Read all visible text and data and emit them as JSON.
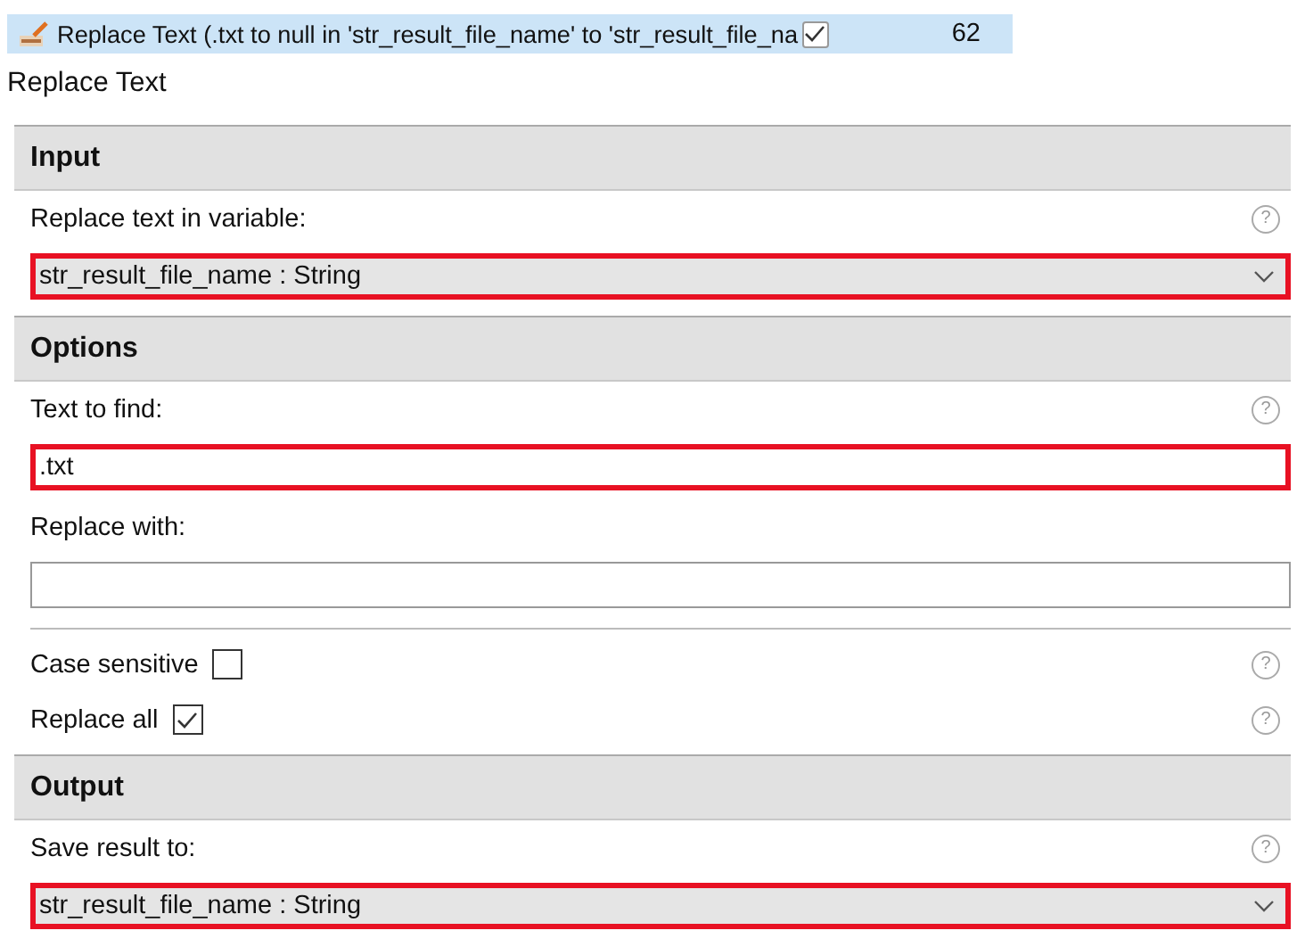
{
  "task_row": {
    "label": "Replace Text (.txt to null in 'str_result_file_name' to 'str_result_file_na",
    "checked": true,
    "number": "62",
    "selected": true
  },
  "title": "Replace Text",
  "sections": [
    {
      "heading": "Input",
      "items": [
        {
          "kind": "label",
          "text": "Replace text in variable:",
          "help": "?"
        },
        {
          "kind": "dropdown",
          "value": "str_result_file_name : String",
          "highlighted": true
        }
      ]
    },
    {
      "heading": "Options",
      "items": [
        {
          "kind": "label",
          "text": "Text to find:",
          "help": "?"
        },
        {
          "kind": "textfield",
          "value": ".txt",
          "highlighted": true
        },
        {
          "kind": "label",
          "text": "Replace with:"
        },
        {
          "kind": "textfield",
          "value": "",
          "highlighted": false
        },
        {
          "kind": "separator"
        },
        {
          "kind": "checkbox",
          "text": "Case sensitive",
          "checked": false,
          "help": "?"
        },
        {
          "kind": "checkbox",
          "text": "Replace all",
          "checked": true,
          "help": "?"
        }
      ]
    },
    {
      "heading": "Output",
      "items": [
        {
          "kind": "label",
          "text": "Save result to:",
          "help": "?"
        },
        {
          "kind": "dropdown",
          "value": "str_result_file_name : String",
          "highlighted": true
        }
      ]
    }
  ]
}
